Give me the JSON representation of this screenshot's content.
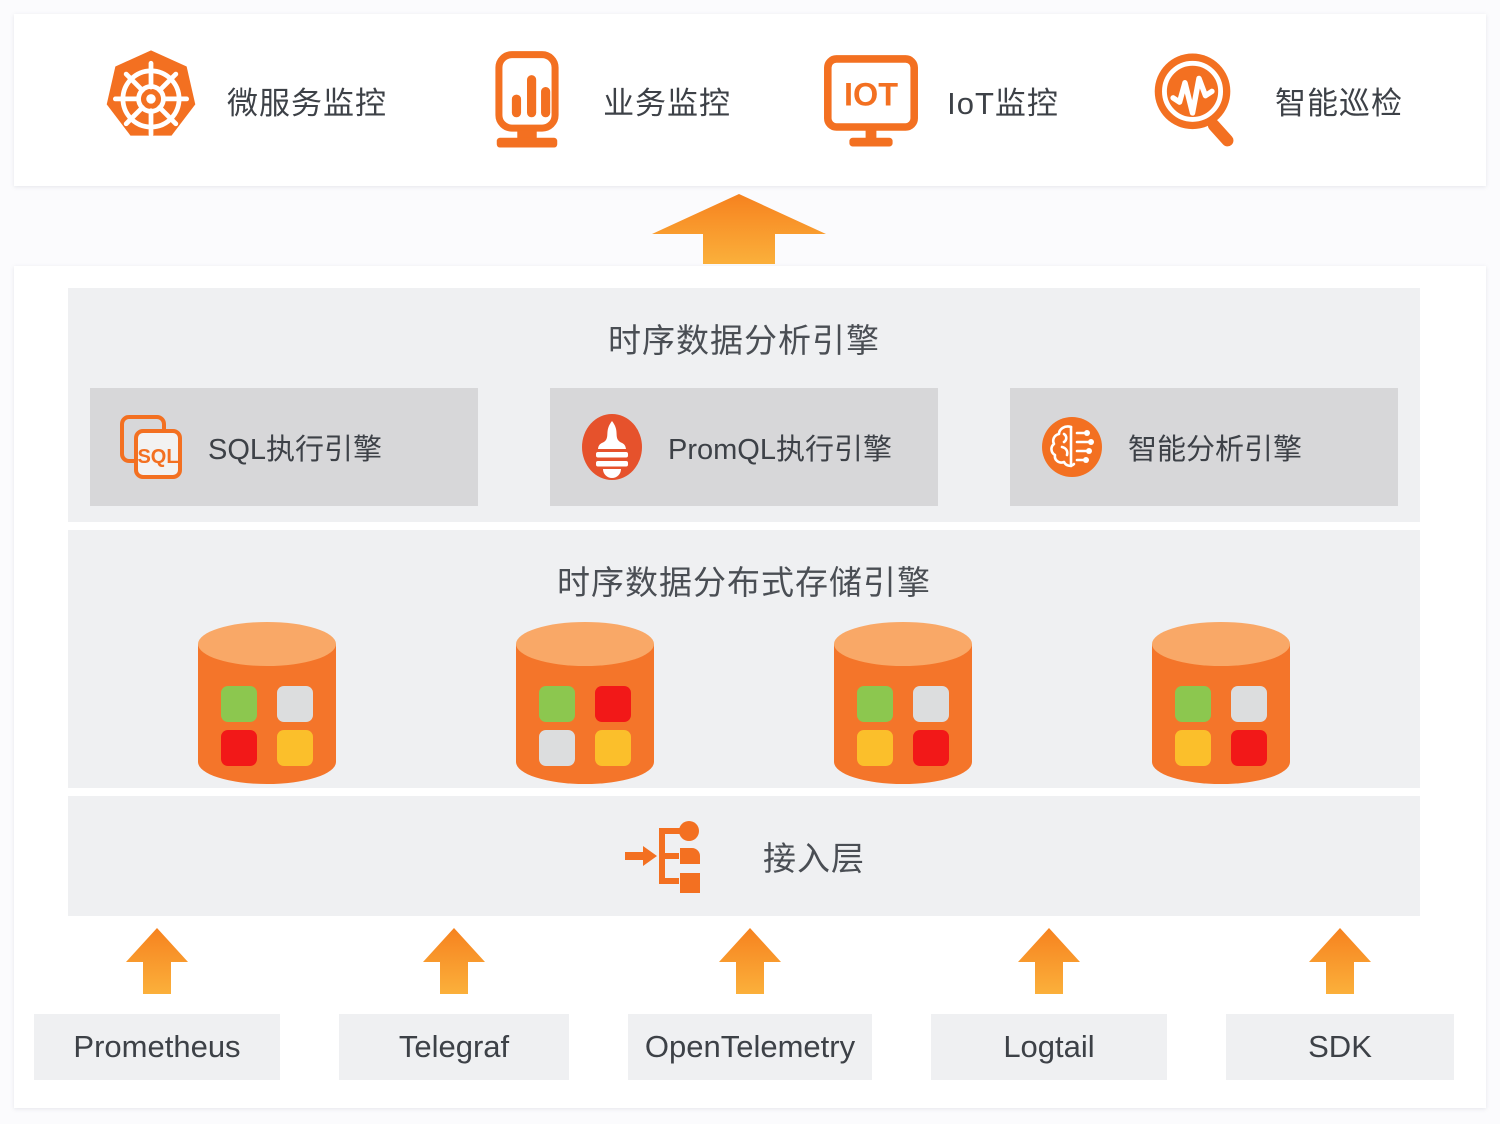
{
  "top_bar": {
    "items": [
      {
        "icon": "kubernetes-helm-icon",
        "label": "微服务监控"
      },
      {
        "icon": "bar-chart-monitor-icon",
        "label": "业务监控"
      },
      {
        "icon": "iot-monitor-icon",
        "label": "IoT监控"
      },
      {
        "icon": "waveform-magnifier-icon",
        "label": "智能巡检"
      }
    ]
  },
  "flow_arrow": {
    "icon": "up-arrow-icon"
  },
  "analysis_section": {
    "title": "时序数据分析引擎",
    "engines": [
      {
        "icon": "sql-documents-icon",
        "label": "SQL执行引擎"
      },
      {
        "icon": "prometheus-torch-icon",
        "label": "PromQL执行引擎"
      },
      {
        "icon": "ai-brain-icon",
        "label": "智能分析引擎"
      }
    ]
  },
  "storage_section": {
    "title": "时序数据分布式存储引擎",
    "nodes": [
      {
        "name": "storage-node-1",
        "tiles": [
          "#8CC74F",
          "#DCDDDE",
          "#F21818",
          "#FBBF2B"
        ]
      },
      {
        "name": "storage-node-2",
        "tiles": [
          "#8CC74F",
          "#F21818",
          "#DCDDDE",
          "#FBBF2B"
        ]
      },
      {
        "name": "storage-node-3",
        "tiles": [
          "#8CC74F",
          "#DCDDDE",
          "#FBBF2B",
          "#F21818"
        ]
      },
      {
        "name": "storage-node-4",
        "tiles": [
          "#8CC74F",
          "#DCDDDE",
          "#FBBF2B",
          "#F21818"
        ]
      }
    ]
  },
  "access_section": {
    "icon": "access-branch-icon",
    "label": "接入层"
  },
  "sources": {
    "items": [
      {
        "arrow": "up-arrow-icon",
        "label": "Prometheus"
      },
      {
        "arrow": "up-arrow-icon",
        "label": "Telegraf"
      },
      {
        "arrow": "up-arrow-icon",
        "label": "OpenTelemetry"
      },
      {
        "arrow": "up-arrow-icon",
        "label": "Logtail"
      },
      {
        "arrow": "up-arrow-icon",
        "label": "SDK"
      }
    ]
  },
  "colors": {
    "brand_orange": "#F37021",
    "prometheus_red": "#E6522C",
    "panel_gray": "#EFF0F2",
    "card_gray": "#D7D7D9",
    "text_dark": "#3D4147",
    "arrow_top": "#F6821F",
    "arrow_bottom": "#FBB03B"
  }
}
